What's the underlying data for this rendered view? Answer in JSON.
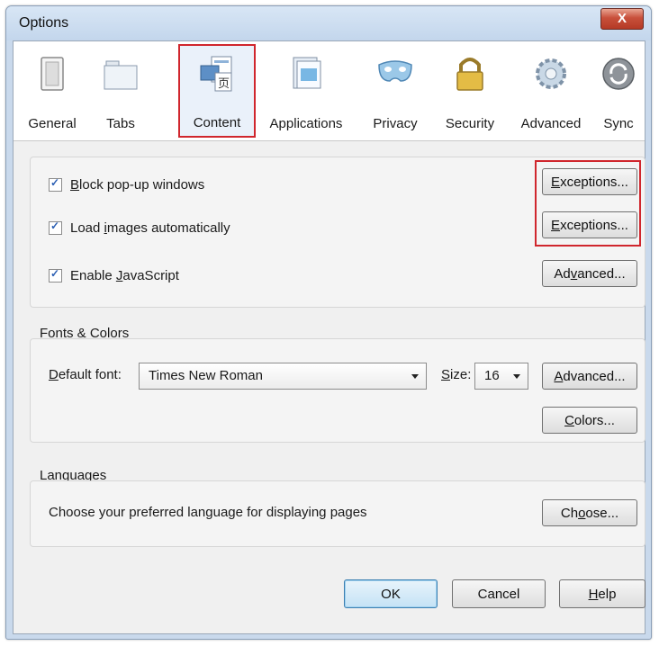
{
  "window": {
    "title": "Options",
    "close_label": "X"
  },
  "tabs": [
    {
      "label": "General",
      "icon": "general-switch-icon"
    },
    {
      "label": "Tabs",
      "icon": "tabs-folder-icon"
    },
    {
      "label": "Content",
      "icon": "content-page-icon",
      "selected": true
    },
    {
      "label": "Applications",
      "icon": "applications-icon"
    },
    {
      "label": "Privacy",
      "icon": "privacy-mask-icon"
    },
    {
      "label": "Security",
      "icon": "security-lock-icon"
    },
    {
      "label": "Advanced",
      "icon": "advanced-gear-icon"
    },
    {
      "label": "Sync",
      "icon": "sync-icon"
    }
  ],
  "content": {
    "block_popups": {
      "pre": "",
      "ul": "B",
      "post": "lock pop-up windows",
      "checked": true
    },
    "load_images": {
      "pre": "Load ",
      "ul": "i",
      "post": "mages automatically",
      "checked": true
    },
    "enable_js": {
      "pre": "Enable ",
      "ul": "J",
      "post": "avaScript",
      "checked": true
    },
    "exceptions1": {
      "pre": "",
      "ul": "E",
      "post": "xceptions..."
    },
    "exceptions2": {
      "pre": "",
      "ul": "E",
      "post": "xceptions..."
    },
    "advanced_js": {
      "pre": "Ad",
      "ul": "v",
      "post": "anced..."
    }
  },
  "fonts": {
    "legend": "Fonts & Colors",
    "default_font_label": {
      "pre": "",
      "ul": "D",
      "post": "efault font:"
    },
    "default_font_value": "Times New Roman",
    "size_label": {
      "pre": "",
      "ul": "S",
      "post": "ize:"
    },
    "size_value": "16",
    "advanced": {
      "pre": "",
      "ul": "A",
      "post": "dvanced..."
    },
    "colors": {
      "pre": "",
      "ul": "C",
      "post": "olors..."
    }
  },
  "languages": {
    "legend": "Languages",
    "description": "Choose your preferred language for displaying pages",
    "choose": {
      "pre": "Ch",
      "ul": "o",
      "post": "ose..."
    }
  },
  "footer": {
    "ok": "OK",
    "cancel": "Cancel",
    "help": {
      "pre": "",
      "ul": "H",
      "post": "elp"
    }
  },
  "colors": {
    "highlight": "#d0262d",
    "checkmark": "#2b5fb3"
  }
}
